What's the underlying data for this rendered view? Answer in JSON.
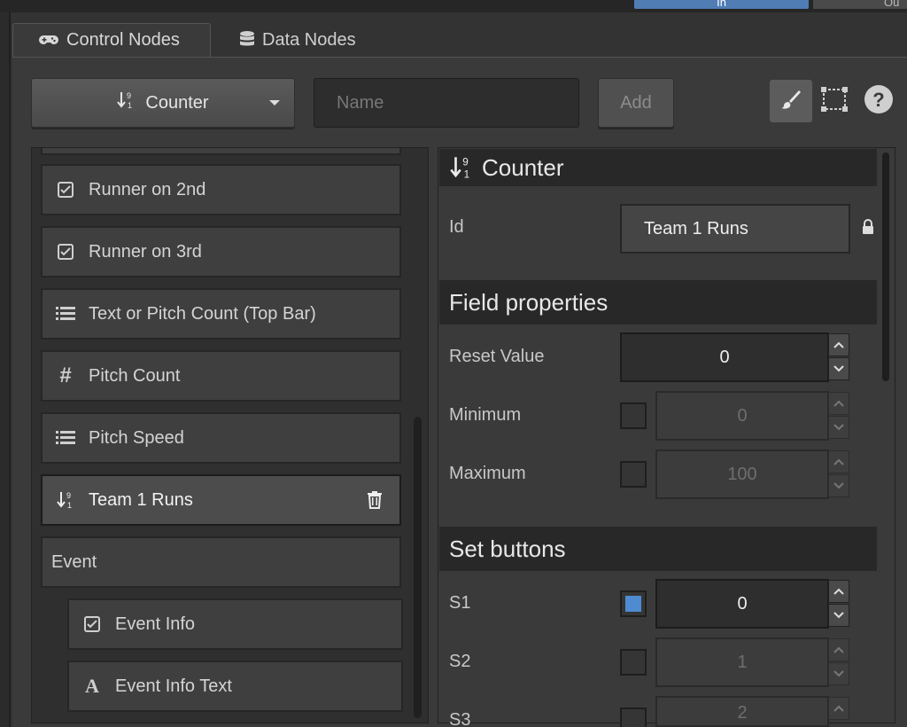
{
  "window": {
    "top_tabs": [
      "In",
      "Ou"
    ]
  },
  "tabs": [
    {
      "label": "Control Nodes",
      "icon": "gamepad-icon",
      "active": true
    },
    {
      "label": "Data Nodes",
      "icon": "database-icon",
      "active": false
    }
  ],
  "toolbar": {
    "type_label": "Counter",
    "type_icon": "sort-numeric-icon",
    "name_placeholder": "Name",
    "name_value": "",
    "add_label": "Add",
    "tools": [
      "paintbrush-icon",
      "frame-select-icon",
      "help-icon"
    ]
  },
  "list": {
    "items": [
      {
        "label": "Runner on 2nd",
        "icon": "checkbox-icon"
      },
      {
        "label": "Runner on 3rd",
        "icon": "checkbox-icon"
      },
      {
        "label": "Text or Pitch Count (Top Bar)",
        "icon": "list-icon"
      },
      {
        "label": "Pitch Count",
        "icon": "hash-icon"
      },
      {
        "label": "Pitch Speed",
        "icon": "list-icon"
      },
      {
        "label": "Team 1 Runs",
        "icon": "sort-numeric-icon",
        "selected": true
      },
      {
        "label": "Event",
        "icon": ""
      },
      {
        "label": "Event Info",
        "icon": "checkbox-icon"
      },
      {
        "label": "Event Info Text",
        "icon": "text-icon"
      }
    ]
  },
  "props": {
    "title": "Counter",
    "id_label": "Id",
    "id_value": "Team 1 Runs",
    "field_section": "Field properties",
    "reset_label": "Reset Value",
    "reset_value": "0",
    "min_label": "Minimum",
    "min_value": "0",
    "min_enabled": false,
    "max_label": "Maximum",
    "max_value": "100",
    "max_enabled": false,
    "set_section": "Set buttons",
    "set_buttons": [
      {
        "label": "S1",
        "value": "0",
        "enabled": true
      },
      {
        "label": "S2",
        "value": "1",
        "enabled": false
      },
      {
        "label": "S3",
        "value": "2",
        "enabled": false
      }
    ]
  },
  "colors": {
    "accent": "#4f8bd0",
    "background": "#333333",
    "section_header": "#282828"
  }
}
